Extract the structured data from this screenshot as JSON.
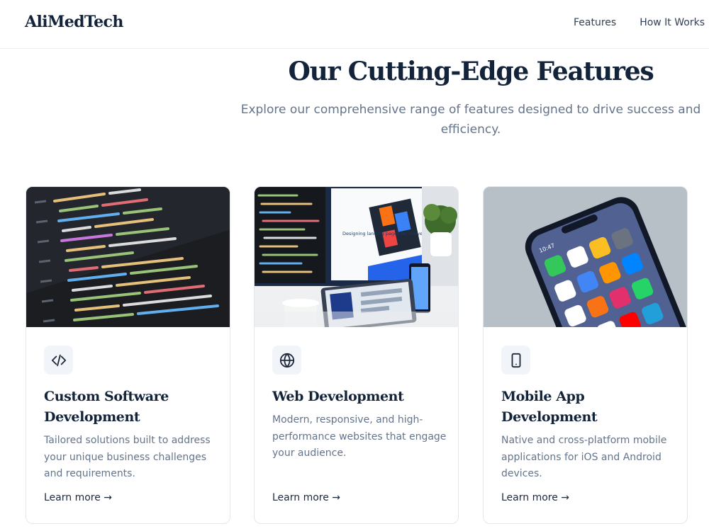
{
  "header": {
    "logo": "AliMedTech",
    "nav": [
      {
        "label": "Features"
      },
      {
        "label": "How It Works"
      }
    ]
  },
  "hero": {
    "title": "Our Cutting-Edge Features",
    "subtitle": "Explore our comprehensive range of features designed to drive success and efficiency."
  },
  "cards": [
    {
      "icon": "code-icon",
      "title": "Custom Software Development",
      "description": "Tailored solutions built to address your unique business challenges and requirements.",
      "link": "Learn more →"
    },
    {
      "icon": "globe-icon",
      "title": "Web Development",
      "description": "Modern, responsive, and high-performance websites that engage your audience.",
      "link": "Learn more →"
    },
    {
      "icon": "smartphone-icon",
      "title": "Mobile App Development",
      "description": "Native and cross-platform mobile applications for iOS and Android devices.",
      "link": "Learn more →"
    }
  ],
  "images": {
    "monitor_heading": "Designing landing pages for conversion",
    "phone_time": "10:47"
  }
}
